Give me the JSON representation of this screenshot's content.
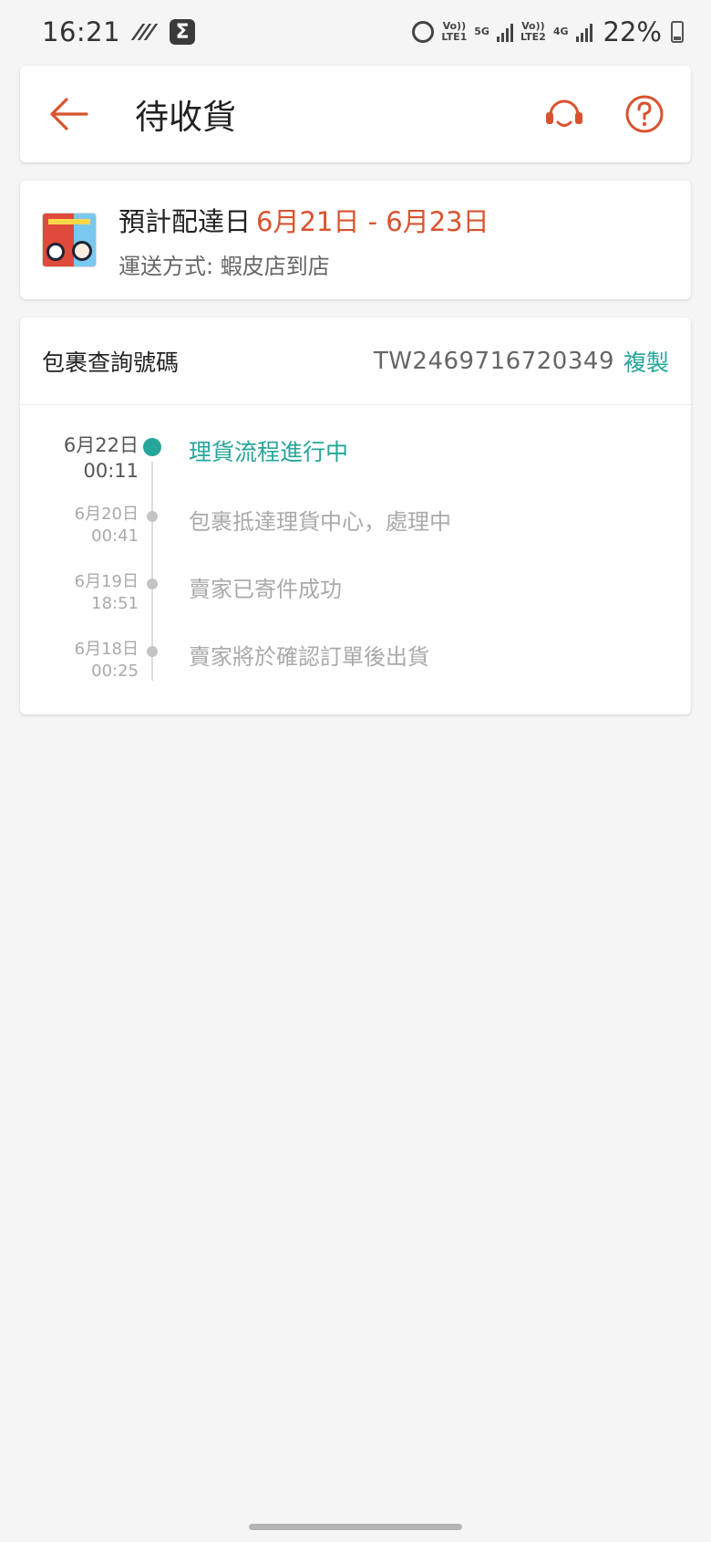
{
  "status_bar": {
    "time": "16:21",
    "network1": "Vo)) LTE1",
    "network1_type": "5G",
    "network2": "Vo)) LTE2",
    "network2_type": "4G",
    "battery": "22%"
  },
  "header": {
    "title": "待收貨",
    "icons": [
      "back-arrow-icon",
      "customer-service-headset-icon",
      "help-question-icon"
    ],
    "accent_color": "#d9532f"
  },
  "delivery": {
    "label": "預計配達日",
    "date_range": "6月21日 - 6月23日",
    "method": "運送方式: 蝦皮店到店"
  },
  "tracking": {
    "label": "包裹查詢號碼",
    "number": "TW2469716720349",
    "copy_label": "複製",
    "events": [
      {
        "date": "6月22日",
        "time": "00:11",
        "text": "理貨流程進行中",
        "active": true
      },
      {
        "date": "6月20日",
        "time": "00:41",
        "text": "包裹抵達理貨中心，處理中",
        "active": false
      },
      {
        "date": "6月19日",
        "time": "18:51",
        "text": "賣家已寄件成功",
        "active": false
      },
      {
        "date": "6月18日",
        "time": "00:25",
        "text": "賣家將於確認訂單後出貨",
        "active": false
      }
    ],
    "active_color": "#26a69a"
  }
}
